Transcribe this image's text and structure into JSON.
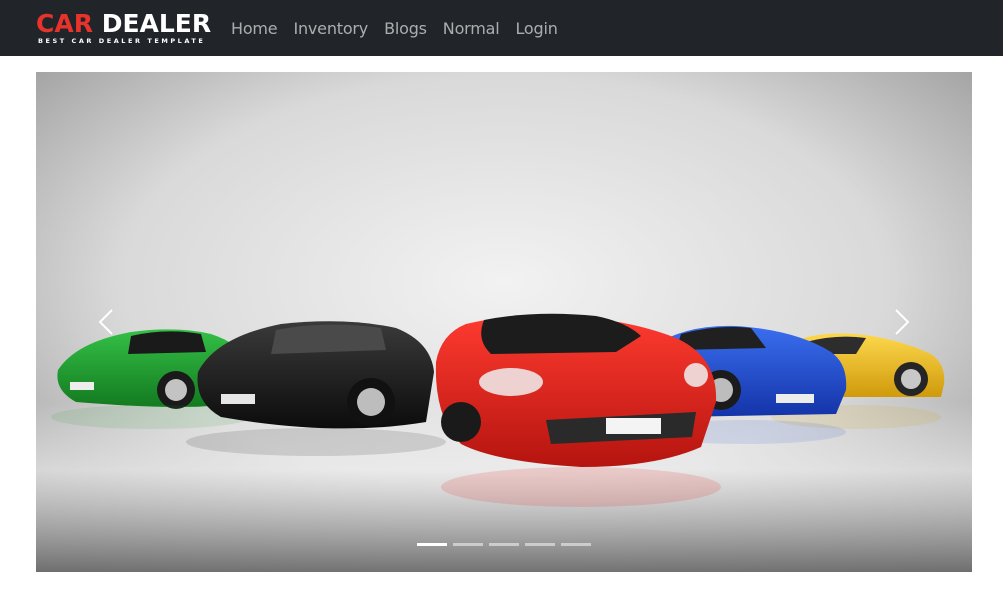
{
  "brand": {
    "logo_prefix": "C",
    "logo_middle": "AR",
    "logo_suffix": "DEALER",
    "tagline": "BEST CAR DEALER TEMPLATE",
    "accent_color": "#e8322c"
  },
  "nav": {
    "items": [
      {
        "label": "Home"
      },
      {
        "label": "Inventory"
      },
      {
        "label": "Blogs"
      },
      {
        "label": "Normal"
      },
      {
        "label": "Login"
      }
    ]
  },
  "carousel": {
    "slide_count": 5,
    "active_index": 0,
    "prev_icon": "chevron-left-icon",
    "next_icon": "chevron-right-icon",
    "image_description_colors": [
      "#1e9a2e",
      "#1b1b1b",
      "#e8231d",
      "#1f4fd6",
      "#f2c21a"
    ]
  },
  "colors": {
    "navbar_bg": "#212529",
    "nav_text": "#a6a8aa"
  }
}
